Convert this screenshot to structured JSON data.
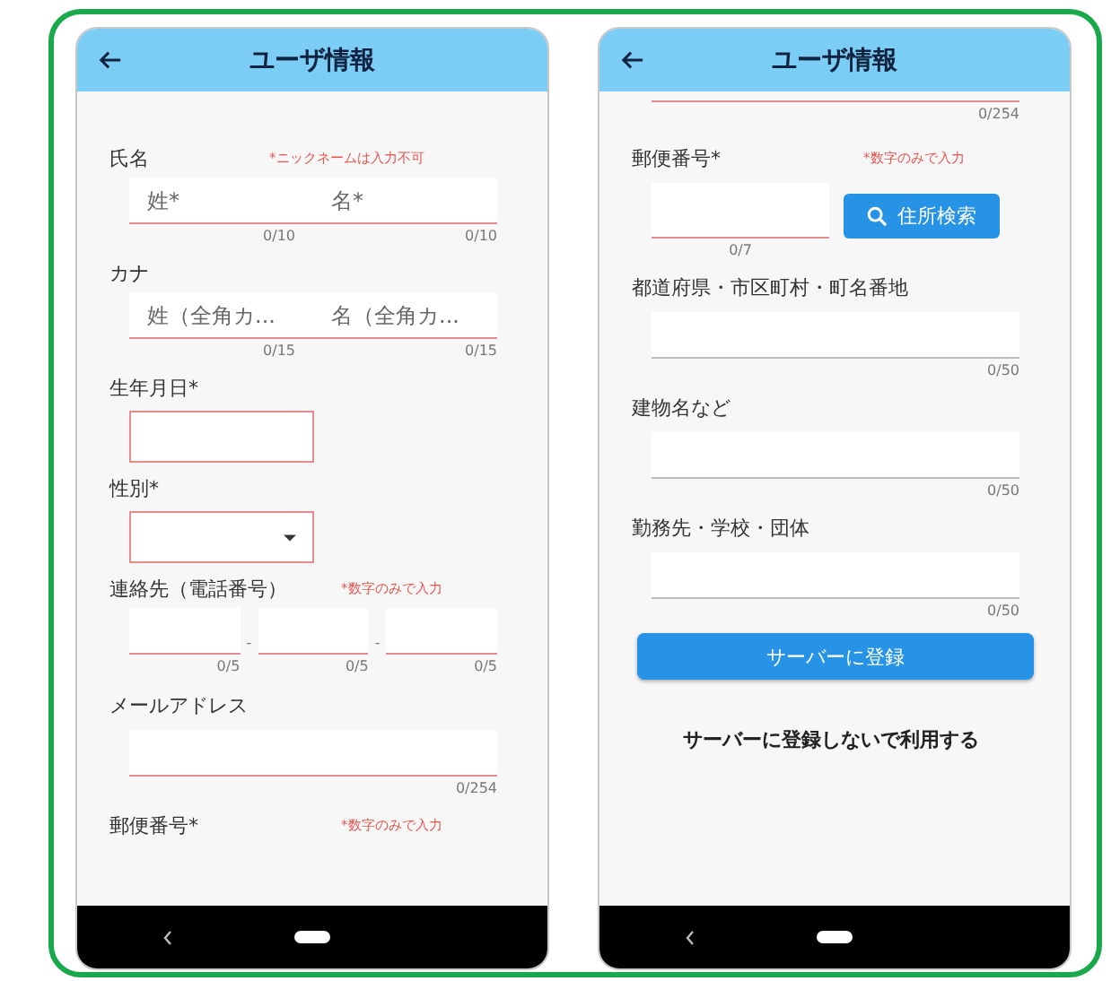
{
  "screens": [
    {
      "title": "ユーザ情報",
      "items": [
        {
          "kind": "label",
          "text": "氏名",
          "note": "*ニックネームは入力不可"
        },
        {
          "kind": "pair",
          "error": true,
          "fields": [
            {
              "placeholder": "姓*",
              "counter": "0/10"
            },
            {
              "placeholder": "名*",
              "counter": "0/10"
            }
          ]
        },
        {
          "kind": "label",
          "text": "カナ"
        },
        {
          "kind": "pair",
          "error": true,
          "fields": [
            {
              "placeholder": "姓（全角カ...",
              "counter": "0/15"
            },
            {
              "placeholder": "名（全角カ...",
              "counter": "0/15"
            }
          ]
        },
        {
          "kind": "label",
          "text": "生年月日*"
        },
        {
          "kind": "box",
          "error": true
        },
        {
          "kind": "label",
          "text": "性別*"
        },
        {
          "kind": "select",
          "error": true
        },
        {
          "kind": "label",
          "text": "連絡先（電話番号）",
          "note": "*数字のみで入力"
        },
        {
          "kind": "triple",
          "error": true,
          "separator": "-",
          "fields": [
            {
              "counter": "0/5"
            },
            {
              "counter": "0/5"
            },
            {
              "counter": "0/5"
            }
          ]
        },
        {
          "kind": "label",
          "text": "メールアドレス"
        },
        {
          "kind": "line",
          "error": true,
          "counter": "0/254"
        },
        {
          "kind": "label",
          "text": "郵便番号*",
          "note": "*数字のみで入力"
        }
      ]
    },
    {
      "title": "ユーザ情報",
      "items": [
        {
          "kind": "tail",
          "error": true,
          "counter": "0/254"
        },
        {
          "kind": "label",
          "text": "郵便番号*",
          "note": "*数字のみで入力"
        },
        {
          "kind": "zip",
          "error": true,
          "counter": "0/7",
          "button": "住所検索"
        },
        {
          "kind": "label",
          "text": "都道府県・市区町村・町名番地"
        },
        {
          "kind": "line",
          "error": false,
          "counter": "0/50"
        },
        {
          "kind": "label",
          "text": "建物名など"
        },
        {
          "kind": "line",
          "error": false,
          "counter": "0/50"
        },
        {
          "kind": "label",
          "text": "勤務先・学校・団体"
        },
        {
          "kind": "line",
          "error": false,
          "counter": "0/50"
        },
        {
          "kind": "primary",
          "text": "サーバーに登録"
        },
        {
          "kind": "link",
          "text": "サーバーに登録しないで利用する"
        }
      ]
    }
  ]
}
